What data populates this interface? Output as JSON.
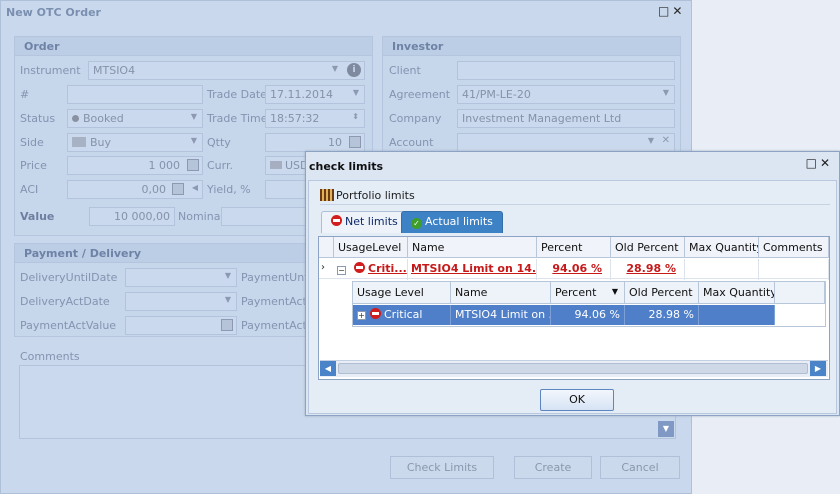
{
  "main": {
    "title": "New OTC Order",
    "order": {
      "header": "Order",
      "instrument_label": "Instrument",
      "instrument_value": "MTSIO4",
      "num_label": "#",
      "trade_date_label": "Trade Date",
      "trade_date_value": "17.11.2014",
      "status_label": "Status",
      "status_value": "Booked",
      "trade_time_label": "Trade Time",
      "trade_time_value": "18:57:32",
      "side_label": "Side",
      "side_value": "Buy",
      "qtty_label": "Qtty",
      "qtty_value": "10",
      "price_label": "Price",
      "price_value": "1 000",
      "curr_label": "Curr.",
      "curr_value": "USD",
      "aci_label": "ACI",
      "aci_value": "0,00",
      "yield_label": "Yield, %",
      "value_label": "Value",
      "value_value": "10 000,00",
      "nominal_label": "Nominal"
    },
    "investor": {
      "header": "Investor",
      "client_label": "Client",
      "agreement_label": "Agreement",
      "agreement_value": "41/PM-LE-20",
      "company_label": "Company",
      "company_value": "Investment Management Ltd",
      "account_label": "Account"
    },
    "payment": {
      "header": "Payment / Delivery",
      "delivery_until_label": "DeliveryUntilDate",
      "payment_until_label": "PaymentUntil",
      "delivery_act_label": "DeliveryActDate",
      "payment_act_date_label": "PaymentActD",
      "payment_act_value_label": "PaymentActValue",
      "payment_act_c_label": "PaymentActC"
    },
    "comments_label": "Comments",
    "buttons": {
      "check_limits": "Check Limits",
      "create": "Create",
      "cancel": "Cancel"
    }
  },
  "dialog": {
    "title": "check limits",
    "section_label": "Portfolio limits",
    "tabs": [
      {
        "label": "Net limits",
        "active": false
      },
      {
        "label": "Actual limits",
        "active": true
      }
    ],
    "grid": {
      "columns": [
        "UsageLevel",
        "Name",
        "Percent",
        "Old Percent",
        "Max Quantity",
        "Comments"
      ],
      "row": {
        "usage_level": "Criti...",
        "name": "MTSIO4 Limit on 14...",
        "percent": "94.06 %",
        "old_percent": "28.98 %",
        "max_quantity": "",
        "comments": ""
      },
      "subgrid": {
        "columns": [
          "Usage Level",
          "Name",
          "Percent",
          "Old Percent",
          "Max Quantity"
        ],
        "row": {
          "usage_level": "Critical",
          "name": "MTSIO4 Limit on ...",
          "percent": "94.06 %",
          "old_percent": "28.98 %",
          "max_quantity": ""
        }
      }
    },
    "ok_label": "OK"
  },
  "colors": {
    "accent": "#3e82c6",
    "critical": "#c61a1a",
    "selection": "#4f7fc9"
  }
}
